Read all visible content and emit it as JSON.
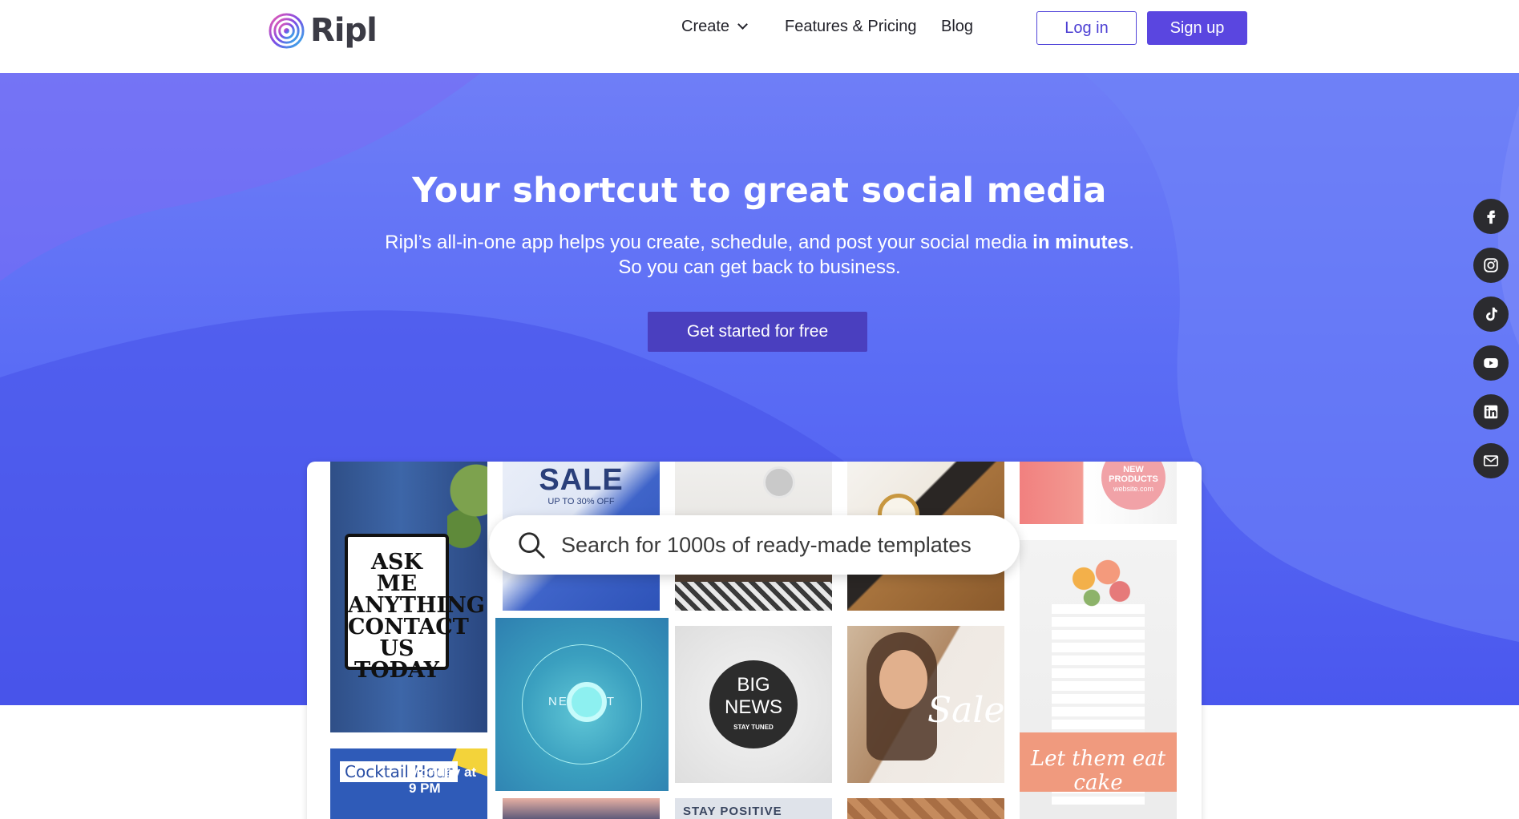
{
  "brand": {
    "name": "Ripl"
  },
  "nav": {
    "create": "Create",
    "features_pricing": "Features & Pricing",
    "blog": "Blog",
    "login": "Log in",
    "signup": "Sign up"
  },
  "hero": {
    "title": "Your shortcut to great social media",
    "subtitle_part1": "Ripl’s all-in-one app helps you create, schedule, and post your social media ",
    "subtitle_bold": "in minutes",
    "subtitle_part2": ".",
    "subtitle_line2": "So you can get back to business.",
    "cta": "Get started for free"
  },
  "search": {
    "placeholder": "Search for 1000s of ready-made templates"
  },
  "socials": [
    {
      "name": "facebook-icon"
    },
    {
      "name": "instagram-icon"
    },
    {
      "name": "tiktok-icon"
    },
    {
      "name": "youtube-icon"
    },
    {
      "name": "linkedin-icon"
    },
    {
      "name": "email-icon"
    }
  ],
  "templates": {
    "ask_me": "ASK ME ANYTHING CONTACT US TODAY",
    "sale": "SALE",
    "sale_sub": "UP TO 30% OFF",
    "new_products": "NEW PRODUCTS",
    "new_products_url": "website.com",
    "cocktail": "Cocktail Hour",
    "monday": "Monday at 9 PM",
    "newuct": "NEW    UCT",
    "big_news": "BIG NEWS",
    "stay_tuned": "STAY TUNED",
    "sale_script": "Sale",
    "let_them": "Let them eat cake",
    "stay_positive": "STAY POSITIVE"
  },
  "colors": {
    "accent": "#5a46e0",
    "cta": "#4a3fbf",
    "hero_bg": "#5b6df5"
  }
}
